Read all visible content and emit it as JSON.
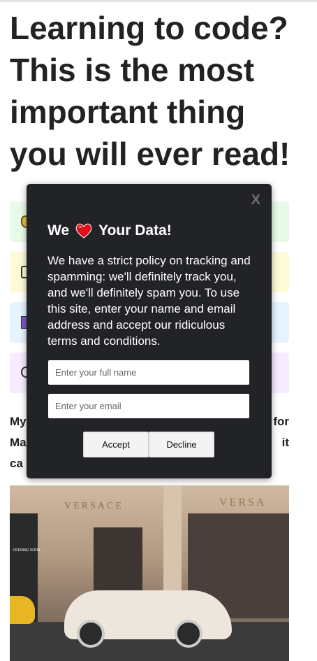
{
  "page": {
    "headline": "Learning to code? This is the most important thing you will ever read!",
    "body_line1_left": "My",
    "body_line1_right": "for",
    "body_line2_left": "Ma",
    "body_line2_right": "it",
    "body_line3_left": "ca"
  },
  "hero_image": {
    "sign_left": "VERSACE",
    "sign_right": "VERSA",
    "store_badge": "OPENING SOON"
  },
  "modal": {
    "close_label": "X",
    "title_before": "We",
    "title_after": "Your Data!",
    "heart_icon": "heart-icon",
    "description": "We have a strict policy on tracking and spamming: we'll definitely track you, and we'll definitely spam you. To use this site, enter your name and email address and accept our ridiculous terms and conditions.",
    "name_placeholder": "Enter your full name",
    "email_placeholder": "Enter your email",
    "accept_label": "Accept",
    "decline_label": "Decline"
  },
  "colors": {
    "modal_bg": "#222327",
    "heart": "#e0101a",
    "stripe_green": "#e8fbe8",
    "stripe_yellow": "#fffbd8",
    "stripe_blue": "#e6f4ff",
    "stripe_purple": "#f7ecff"
  }
}
